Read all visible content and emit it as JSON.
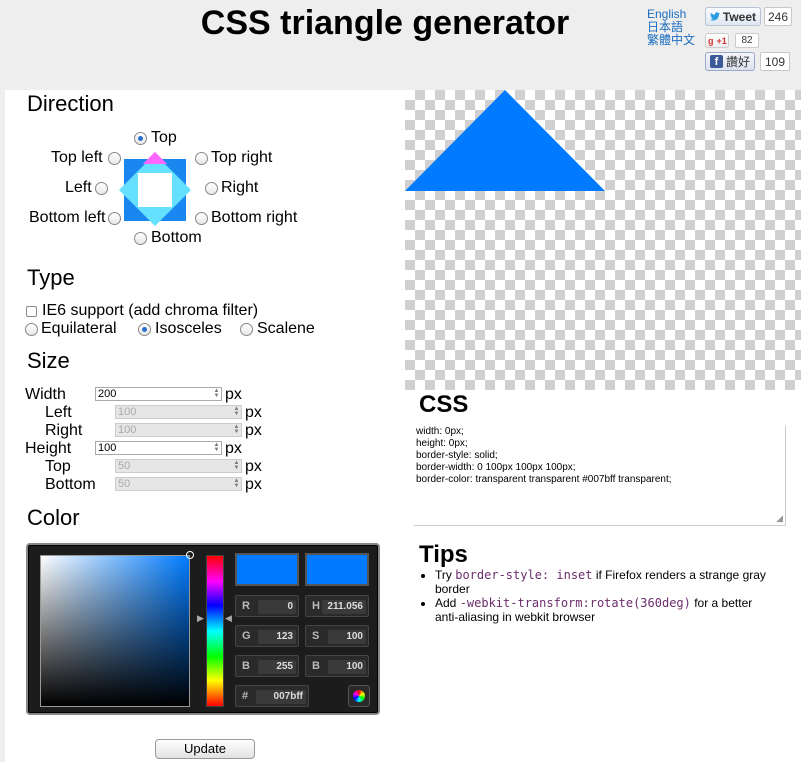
{
  "header": {
    "title": "CSS triangle generator",
    "languages": [
      "English",
      "日本語",
      "繁體中文"
    ],
    "tweet": {
      "label": "Tweet",
      "count": "246"
    },
    "gplus": {
      "label": "+1",
      "count": "82"
    },
    "facebook": {
      "label": "讚好",
      "count": "109"
    }
  },
  "direction": {
    "heading": "Direction",
    "options": {
      "top": "Top",
      "top_left": "Top left",
      "top_right": "Top right",
      "left": "Left",
      "right": "Right",
      "bottom_left": "Bottom left",
      "bottom_right": "Bottom right",
      "bottom": "Bottom"
    },
    "selected": "Top"
  },
  "type": {
    "heading": "Type",
    "ie6_label": "IE6 support (add chroma filter)",
    "options": {
      "equilateral": "Equilateral",
      "isosceles": "Isosceles",
      "scalene": "Scalene"
    },
    "selected": "Isosceles"
  },
  "size": {
    "heading": "Size",
    "unit": "px",
    "width": {
      "label": "Width",
      "value": "200"
    },
    "left": {
      "label": "Left",
      "value": "100"
    },
    "right": {
      "label": "Right",
      "value": "100"
    },
    "height": {
      "label": "Height",
      "value": "100"
    },
    "top": {
      "label": "Top",
      "value": "50"
    },
    "bottom": {
      "label": "Bottom",
      "value": "50"
    }
  },
  "color": {
    "heading": "Color",
    "hex": "007bff",
    "hex_label": "#",
    "swatch_color": "#007bff",
    "fields": {
      "r": {
        "label": "R",
        "value": "0"
      },
      "g": {
        "label": "G",
        "value": "123"
      },
      "b": {
        "label": "B",
        "value": "255"
      },
      "h": {
        "label": "H",
        "value": "211.056"
      },
      "s": {
        "label": "S",
        "value": "100"
      },
      "br": {
        "label": "B",
        "value": "100"
      }
    }
  },
  "update_label": "Update",
  "css": {
    "heading": "CSS",
    "lines": [
      "width: 0px;",
      "height: 0px;",
      "border-style: solid;",
      "border-width: 0 100px 100px 100px;",
      "border-color: transparent transparent #007bff transparent;"
    ]
  },
  "tips": {
    "heading": "Tips",
    "items": [
      {
        "pre": "Try ",
        "code": "border-style: inset",
        "post": " if Firefox renders a strange gray border"
      },
      {
        "pre": "Add ",
        "code": "-webkit-transform:rotate(360deg)",
        "post": " for a better anti-aliasing in webkit browser"
      }
    ]
  },
  "colors": {
    "accent": "#007bff",
    "arrow_light": "#66e0ff",
    "arrow_top": "#ff66ff"
  }
}
